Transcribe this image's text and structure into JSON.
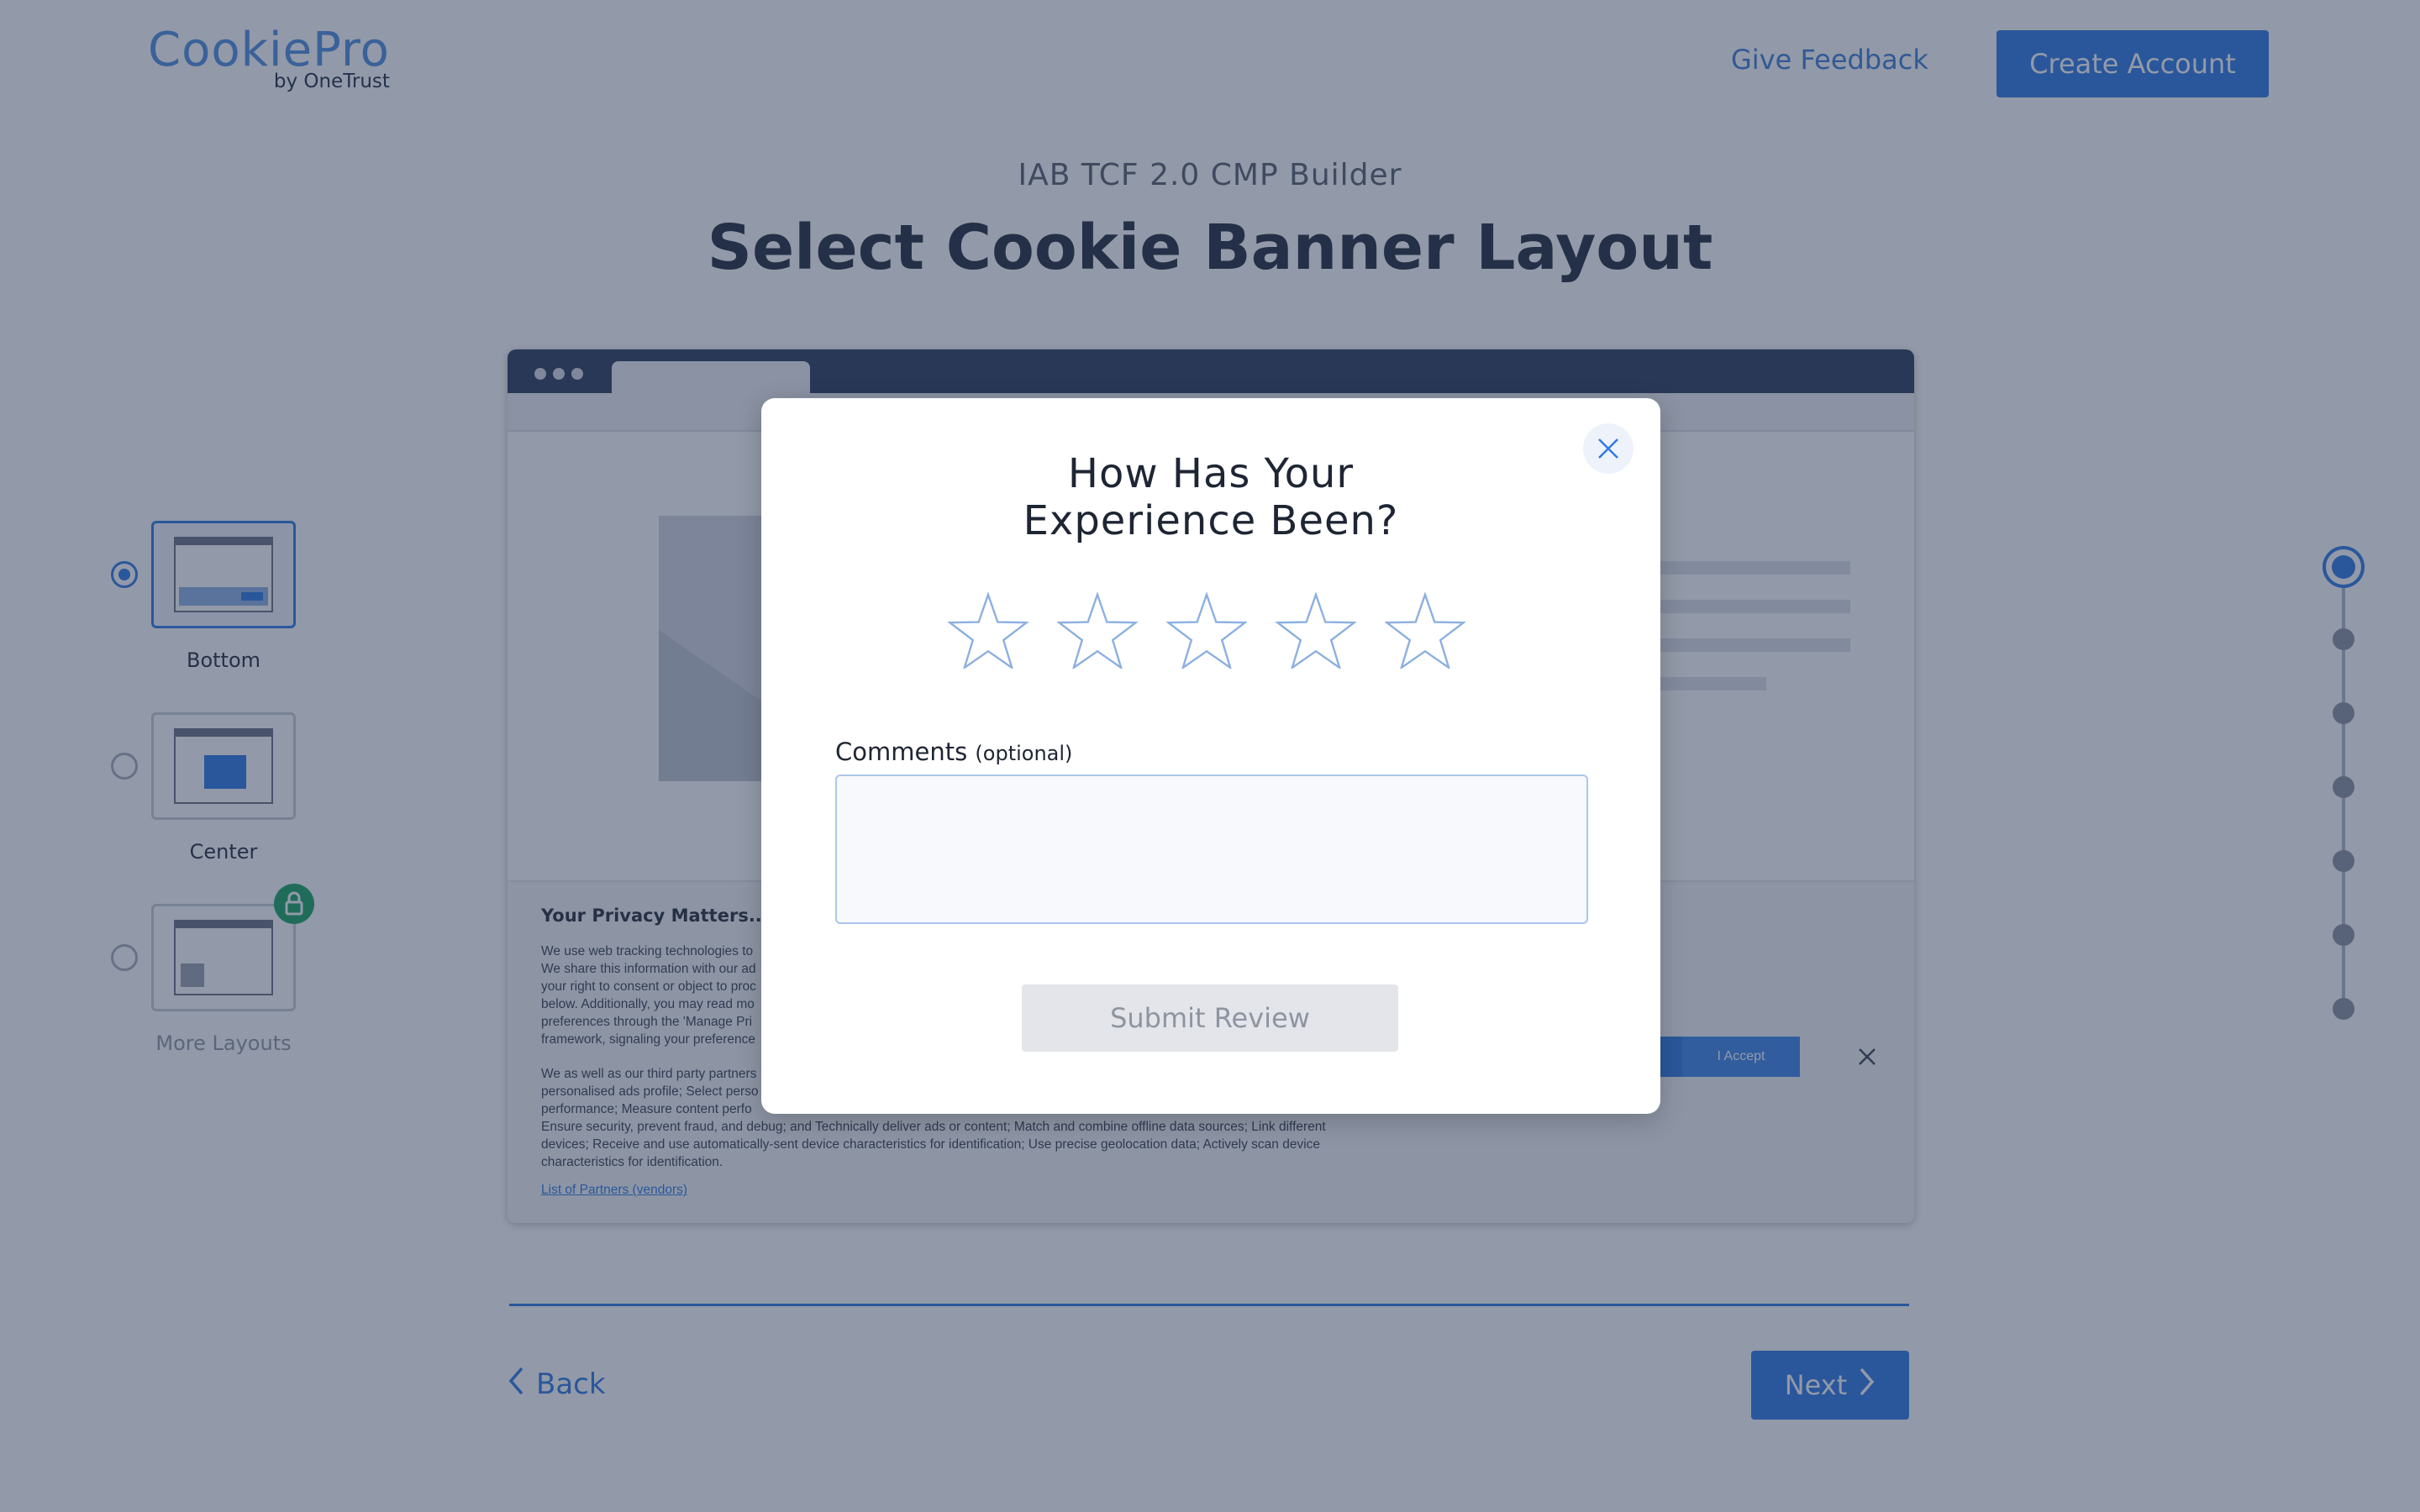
{
  "header": {
    "logo_main": "CookiePro",
    "logo_sub": "by OneTrust",
    "feedback_link": "Give Feedback",
    "create_account": "Create Account"
  },
  "page": {
    "subtitle": "IAB TCF 2.0 CMP Builder",
    "title": "Select Cookie Banner Layout"
  },
  "layouts": [
    {
      "label": "Bottom",
      "selected": true
    },
    {
      "label": "Center",
      "selected": false
    },
    {
      "label": "More Layouts",
      "selected": false,
      "locked": true
    }
  ],
  "banner": {
    "title": "Your Privacy Matters...",
    "para1": [
      "We use web tracking technologies to",
      "We share this information with our ad",
      "your right to consent or object to proc",
      "below. Additionally, you may read mo",
      "preferences through the 'Manage Pri",
      "framework, signaling your preference"
    ],
    "para2": [
      "We as well as our third party partners",
      "personalised ads profile; Select perso",
      "performance; Measure content perfo",
      "Ensure security, prevent fraud, and debug; and Technically deliver ads or content; Match and combine offline data sources; Link different",
      "devices; Receive and use automatically-sent device characteristics for identification; Use precise geolocation data; Actively scan device",
      "characteristics for identification."
    ],
    "link": "List of Partners (vendors)",
    "accept_button": "I Accept"
  },
  "navigation": {
    "back": "Back",
    "next": "Next"
  },
  "steps": {
    "total": 7,
    "current": 1
  },
  "modal": {
    "title_line1": "How Has Your",
    "title_line2": "Experience Been?",
    "rating": {
      "max": 5,
      "value": 0
    },
    "comments_label": "Comments",
    "comments_optional": "(optional)",
    "comments_value": "",
    "submit": "Submit Review"
  },
  "colors": {
    "accent": "#2f7ae5",
    "overlay": "#263452",
    "lock_badge": "#1ba563",
    "star_outline": "#8cb0e0"
  },
  "icons": {
    "modal_close": "close-icon",
    "star": "star-outline-icon",
    "back": "chevron-left-icon",
    "next": "chevron-right-icon",
    "lock": "lock-icon"
  }
}
